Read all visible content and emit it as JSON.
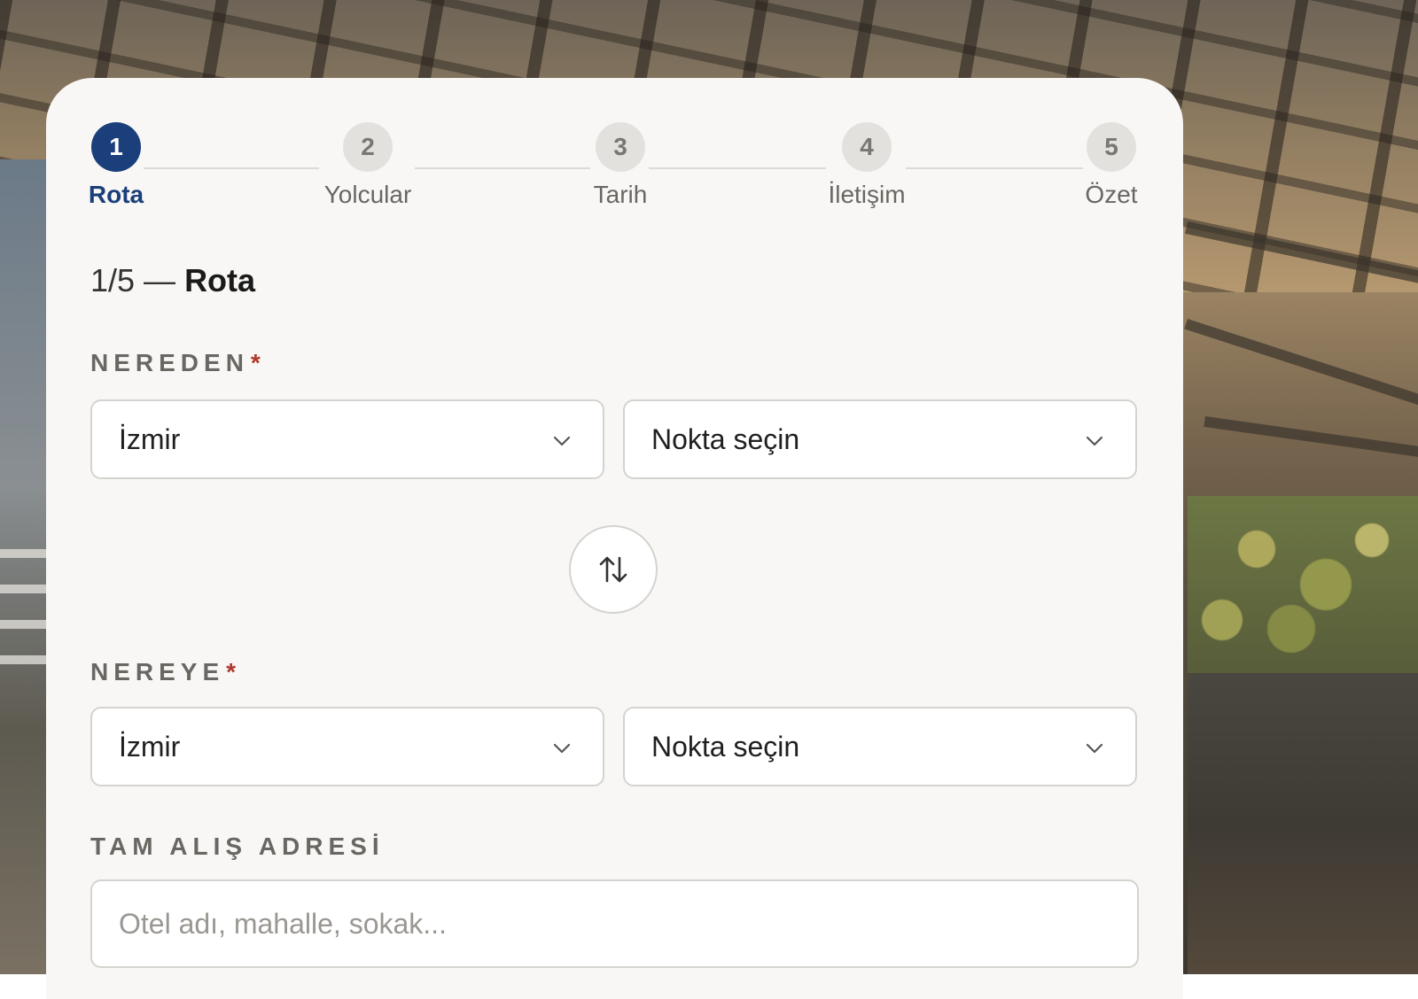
{
  "stepper": {
    "steps": [
      {
        "number": "1",
        "label": "Rota",
        "active": true
      },
      {
        "number": "2",
        "label": "Yolcular",
        "active": false
      },
      {
        "number": "3",
        "label": "Tarih",
        "active": false
      },
      {
        "number": "4",
        "label": "İletişim",
        "active": false
      },
      {
        "number": "5",
        "label": "Özet",
        "active": false
      }
    ]
  },
  "step_heading": {
    "progress": "1/5 —",
    "name": "Rota"
  },
  "from": {
    "label": "NEREDEN",
    "required_mark": "*",
    "city_value": "İzmir",
    "point_value": "Nokta seçin"
  },
  "to": {
    "label": "NEREYE",
    "required_mark": "*",
    "city_value": "İzmir",
    "point_value": "Nokta seçin"
  },
  "address": {
    "label": "TAM ALIŞ ADRESİ",
    "placeholder": "Otel adı, mahalle, sokak..."
  },
  "colors": {
    "accent": "#1b3f7a",
    "required": "#b0382c"
  },
  "icons": {
    "dropdown": "chevron-down-icon",
    "swap": "swap-vertical-icon"
  }
}
